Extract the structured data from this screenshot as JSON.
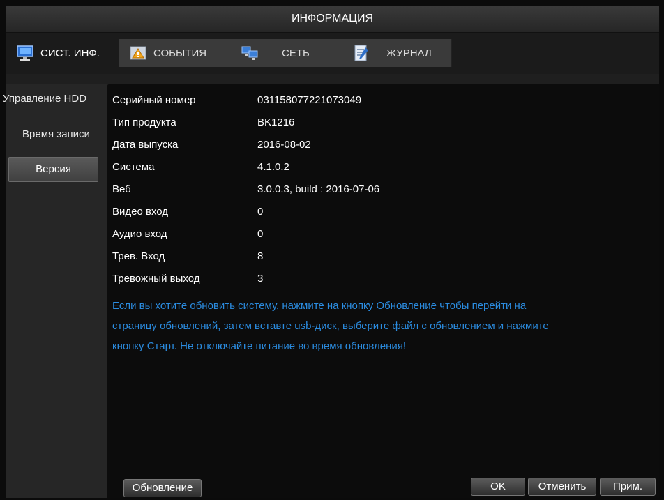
{
  "window": {
    "title": "ИНФОРМАЦИЯ"
  },
  "tabs": [
    {
      "label": "СИСТ. ИНФ.",
      "icon": "monitor-icon",
      "active": true
    },
    {
      "label": "СОБЫТИЯ",
      "icon": "warning-icon",
      "active": false
    },
    {
      "label": "СЕТЬ",
      "icon": "network-icon",
      "active": false
    },
    {
      "label": "ЖУРНАЛ",
      "icon": "log-icon",
      "active": false
    }
  ],
  "sidebar": {
    "items": [
      {
        "label": "Управление HDD"
      },
      {
        "label": "Время записи"
      },
      {
        "label": "Версия",
        "selected": true
      }
    ]
  },
  "info": {
    "rows": [
      {
        "label": "Серийный номер",
        "value": "031158077221073049"
      },
      {
        "label": "Тип продукта",
        "value": "BK1216"
      },
      {
        "label": "Дата выпуска",
        "value": "2016-08-02"
      },
      {
        "label": "Система",
        "value": "4.1.0.2"
      },
      {
        "label": "Веб",
        "value": "3.0.0.3, build : 2016-07-06"
      },
      {
        "label": "Видео вход",
        "value": "0"
      },
      {
        "label": "Аудио вход",
        "value": "0"
      },
      {
        "label": "Трев. Вход",
        "value": "8"
      },
      {
        "label": "Тревожный выход",
        "value": "3"
      }
    ],
    "notice": "Если вы хотите обновить систему, нажмите на кнопку Обновление чтобы перейти на страницу обновлений, затем вставте usb-диск, выберите файл с обновлением и нажмите кнопку Старт. Не отключайте питание во время обновления!"
  },
  "buttons": {
    "update": "Обновление",
    "ok": "OK",
    "cancel": "Отменить",
    "apply": "Прим."
  },
  "colors": {
    "notice": "#2b8ce0",
    "background": "#0c0c0c"
  }
}
